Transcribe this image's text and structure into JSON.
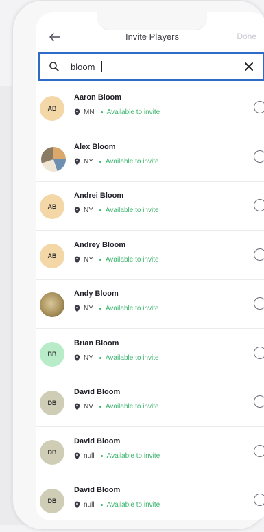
{
  "header": {
    "title": "Invite Players",
    "done_label": "Done"
  },
  "search": {
    "value": "bloom",
    "placeholder": ""
  },
  "players": [
    {
      "initials": "AB",
      "name": "Aaron Bloom",
      "state": "MN",
      "status": "Available to invite",
      "avatar_color": "#f3d7a6"
    },
    {
      "initials": "",
      "name": "Alex Bloom",
      "state": "NY",
      "status": "Available to invite",
      "avatar_color": "#ffffff"
    },
    {
      "initials": "AB",
      "name": "Andrei Bloom",
      "state": "NY",
      "status": "Available to invite",
      "avatar_color": "#f3d7a6"
    },
    {
      "initials": "AB",
      "name": "Andrey Bloom",
      "state": "NY",
      "status": "Available to invite",
      "avatar_color": "#f3d7a6"
    },
    {
      "initials": "",
      "name": "Andy Bloom",
      "state": "NY",
      "status": "Available to invite",
      "avatar_color": "#a8945e"
    },
    {
      "initials": "BB",
      "name": "Brian Bloom",
      "state": "NY",
      "status": "Available to invite",
      "avatar_color": "#b8ecc9"
    },
    {
      "initials": "DB",
      "name": "David Bloom",
      "state": "NV",
      "status": "Available to invite",
      "avatar_color": "#cfcdb5"
    },
    {
      "initials": "DB",
      "name": "David Bloom",
      "state": "null",
      "status": "Available to invite",
      "avatar_color": "#cfcdb5"
    },
    {
      "initials": "DB",
      "name": "David Bloom",
      "state": "null",
      "status": "Available to invite",
      "avatar_color": "#cfcdb5"
    }
  ],
  "colors": {
    "accent": "#2e6ac8",
    "available": "#3cb46e"
  },
  "icons": {
    "back": "arrow-left-icon",
    "search": "search-icon",
    "clear": "close-icon",
    "location": "map-pin-icon"
  }
}
